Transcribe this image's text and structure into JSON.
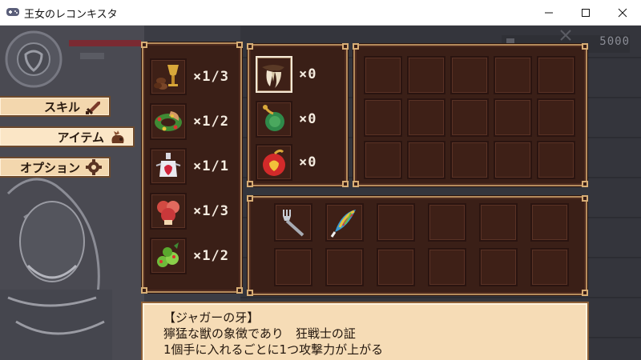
{
  "window": {
    "title": "王女のレコンキスタ",
    "controls": [
      "minimize",
      "maximize",
      "close"
    ]
  },
  "hud": {
    "gold": "5000"
  },
  "menu": {
    "tabs": [
      {
        "label": "スキル",
        "icon": "sword-icon",
        "active": false
      },
      {
        "label": "アイテム",
        "icon": "pouch-icon",
        "active": true
      },
      {
        "label": "オプション",
        "icon": "gear-icon",
        "active": false
      }
    ]
  },
  "key_items": [
    {
      "name": "goblet-and-beans",
      "count": "×1/3"
    },
    {
      "name": "holly-wreath",
      "count": "×1/2"
    },
    {
      "name": "heart-potion-flask",
      "count": "×1/1"
    },
    {
      "name": "red-mushroom",
      "count": "×1/3"
    },
    {
      "name": "green-berries",
      "count": "×1/2"
    }
  ],
  "trophies": [
    {
      "name": "jaguar-fang",
      "count": "×0"
    },
    {
      "name": "green-token",
      "count": "×0"
    },
    {
      "name": "red-apple-heart",
      "count": "×0"
    }
  ],
  "equipment_slots": [
    {
      "name": "silver-fork"
    },
    {
      "name": "rainbow-feather"
    }
  ],
  "description": {
    "line1": "【ジャガーの牙】",
    "line2": "獰猛な獣の象徴であり　狂戦士の証",
    "line3": "1個手に入れるごとに1つ攻撃力が上がる"
  },
  "colors": {
    "panel_bg": "#3a1f17",
    "panel_border": "#b58b5c",
    "tab_bg": "#f3d7ae",
    "desc_bg": "#f6dcb6"
  }
}
